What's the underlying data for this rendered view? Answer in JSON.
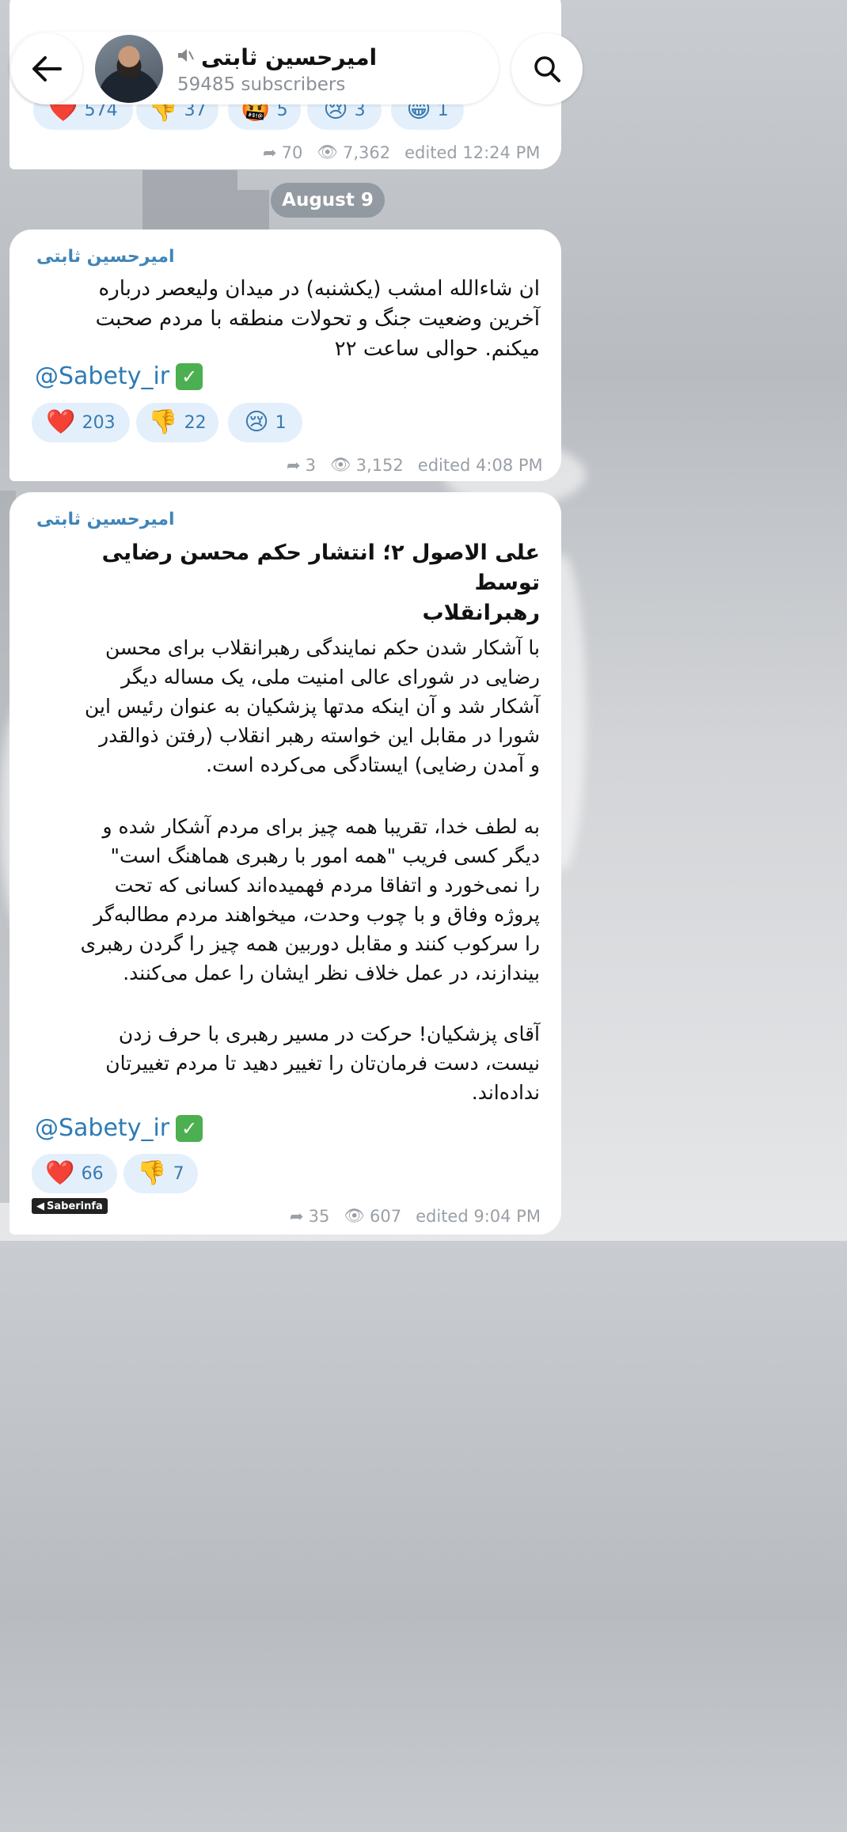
{
  "header": {
    "channel_title": "امیرحسین ثابتی",
    "subscribers": "59485 subscribers",
    "muted_icon": "speaker-muted-icon",
    "back_icon": "arrow-left-icon",
    "search_icon": "search-icon"
  },
  "date_separator": "August 9",
  "messages": [
    {
      "reactions": [
        {
          "emoji": "❤️",
          "count": "574"
        },
        {
          "emoji": "👎",
          "count": "37"
        },
        {
          "emoji": "🤬",
          "count": "5"
        },
        {
          "emoji": "😢",
          "count": "3"
        },
        {
          "emoji": "😁",
          "count": "1"
        }
      ],
      "forwards": "70",
      "views": "7,362",
      "time": "edited 12:24 PM"
    },
    {
      "author": "امیرحسین ثابتی",
      "text": "ان شاءالله امشب (یکشنبه) در میدان ولیعصر درباره\nآخرین وضعیت جنگ و تحولات منطقه با مردم صحبت\nمیکنم. حوالی ساعت ۲۲",
      "handle": "@Sabety_ir",
      "reactions": [
        {
          "emoji": "❤️",
          "count": "203"
        },
        {
          "emoji": "👎",
          "count": "22"
        },
        {
          "emoji": "😢",
          "count": "1"
        }
      ],
      "forwards": "3",
      "views": "3,152",
      "time": "edited 4:08 PM"
    },
    {
      "author": "امیرحسین ثابتی",
      "headline": "علی الاصول ۲؛ انتشار حکم محسن رضایی توسط\nرهبرانقلاب",
      "para1": "با آشکار شدن حکم نمایندگی رهبرانقلاب برای محسن\nرضایی در شورای عالی امنیت ملی، یک مساله دیگر\nآشکار شد و آن اینکه مدتها پزشکیان به عنوان رئیس این\nشورا در مقابل این خواسته رهبر انقلاب (رفتن ذوالقدر\nو آمدن رضایی) ایستادگی می‌کرده است.",
      "para2": "به لطف خدا، تقریبا همه چیز برای مردم آشکار شده و\nدیگر کسی فریب \"همه امور با رهبری هماهنگ است\"\nرا نمی‌خورد و اتفاقا مردم فهمیده‌اند کسانی که تحت\nپروژه وفاق و با چوب وحدت، میخواهند مردم مطالبه‌گر\nرا سرکوب کنند و مقابل دوربین همه چیز را گردن رهبری\nبیندازند، در عمل خلاف نظر ایشان را عمل می‌کنند.",
      "para3": "آقای پزشکیان! حرکت در مسیر رهبری با حرف زدن\nنیست، دست فرمان‌تان را تغییر دهید تا مردم تغییرتان\nنداده‌اند.",
      "handle": "@Sabety_ir",
      "reactions": [
        {
          "emoji": "❤️",
          "count": "66"
        },
        {
          "emoji": "👎",
          "count": "7"
        }
      ],
      "forwards": "35",
      "views": "607",
      "time": "edited 9:04 PM"
    }
  ],
  "watermark": "Saberinfa"
}
